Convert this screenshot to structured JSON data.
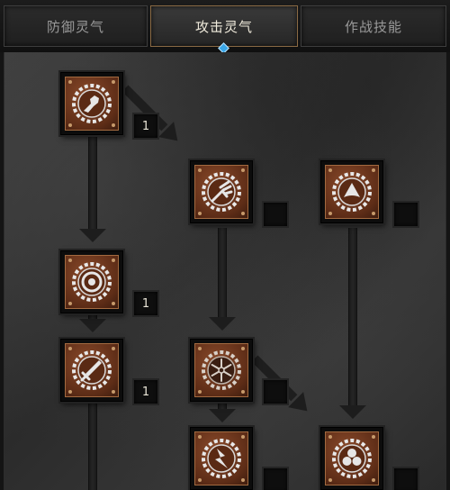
{
  "tabs": [
    {
      "label": "防御灵气"
    },
    {
      "label": "攻击灵气"
    },
    {
      "label": "作战技能"
    }
  ],
  "active_tab": 1,
  "skills": [
    {
      "icon": "fist-icon",
      "level": "1"
    },
    {
      "icon": "trident-icon",
      "level": ""
    },
    {
      "icon": "shield-icon",
      "level": ""
    },
    {
      "icon": "target-ring-icon",
      "level": "1"
    },
    {
      "icon": "sword-icon",
      "level": "1"
    },
    {
      "icon": "snowflake-icon",
      "level": ""
    },
    {
      "icon": "lightning-icon",
      "level": ""
    },
    {
      "icon": "trefoil-icon",
      "level": ""
    }
  ],
  "colors": {
    "plate": "#6a3a20",
    "active_tab_border": "#8a6a44",
    "indicator": "#3aa7e8"
  }
}
